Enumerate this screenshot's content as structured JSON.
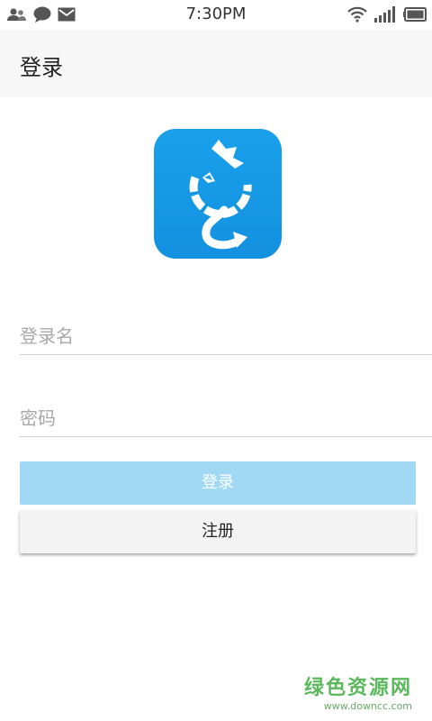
{
  "status_bar": {
    "time": "7:30PM",
    "left_icons": [
      "contacts-icon",
      "chat-bubble-icon",
      "mail-icon"
    ],
    "right_icons": [
      "wifi-icon",
      "signal-icon",
      "battery-icon"
    ]
  },
  "header": {
    "title": "登录"
  },
  "logo": {
    "icon": "app-logo-icon",
    "color": "#1a9be6"
  },
  "form": {
    "username_placeholder": "登录名",
    "username_value": "",
    "password_placeholder": "密码",
    "password_value": ""
  },
  "buttons": {
    "login_label": "登录",
    "register_label": "注册"
  },
  "colors": {
    "login_button": "#a1d9f5",
    "register_button": "#f3f3f3",
    "header_bg": "#f7f7f7"
  },
  "watermark": {
    "name": "绿色资源网",
    "url": "www.downcc.com"
  }
}
